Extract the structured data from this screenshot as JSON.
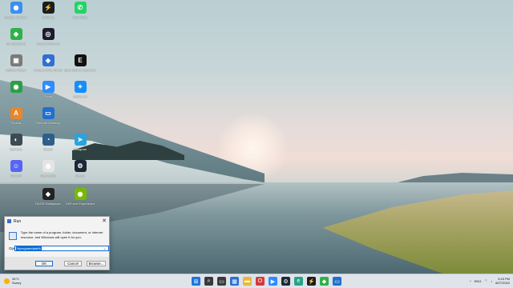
{
  "desktop_icons": [
    {
      "label": "Google Chrome",
      "icon": "chrome-icon",
      "color": "#3c8ef0",
      "glyph": "◉"
    },
    {
      "label": "Winamp",
      "icon": "winamp-icon",
      "color": "#1d1d1d",
      "glyph": "⚡"
    },
    {
      "label": "WhatsApp",
      "icon": "whatsapp-icon",
      "color": "#25d366",
      "glyph": "✆"
    },
    {
      "label": "BlueStacks 5",
      "icon": "bluestacks-icon",
      "color": "#2fb14a",
      "glyph": "◆"
    },
    {
      "label": "Ubisoft Connect",
      "icon": "ubisoft-icon",
      "color": "#1c1c2e",
      "glyph": "◎"
    },
    {
      "label": "Roblox Player",
      "icon": "roblox-icon",
      "color": "#7a7a7a",
      "glyph": "▣"
    },
    {
      "label": "Heroes of the Storm",
      "icon": "heroes-of-the-storm-icon",
      "color": "#2f6fd6",
      "glyph": "◈"
    },
    {
      "label": "Epic Games Launcher",
      "icon": "epic-games-icon",
      "color": "#111111",
      "glyph": "E"
    },
    {
      "label": "",
      "icon": "app-icon",
      "color": "#2d9e47",
      "glyph": "◉"
    },
    {
      "label": "Zoom",
      "icon": "zoom-icon",
      "color": "#2d8cff",
      "glyph": "▶"
    },
    {
      "label": "Battle.net",
      "icon": "battlenet-icon",
      "color": "#148eff",
      "glyph": "✦"
    },
    {
      "label": "Foobar",
      "icon": "foobar-icon",
      "color": "#e8872c",
      "glyph": "A"
    },
    {
      "label": "Remote Desktop",
      "icon": "remote-desktop-icon",
      "color": "#1f6fd1",
      "glyph": "▭"
    },
    {
      "label": "GeForce",
      "icon": "geforce-icon",
      "color": "#3c4a55",
      "glyph": "◐"
    },
    {
      "label": "Steam",
      "icon": "steam-icon",
      "color": "#2e5f8a",
      "glyph": "◔"
    },
    {
      "label": "Telegram",
      "icon": "telegram-icon",
      "color": "#2aa3df",
      "glyph": "➤"
    },
    {
      "label": "Discord",
      "icon": "discord-icon",
      "color": "#5865f2",
      "glyph": "☺"
    },
    {
      "label": "Overwatch",
      "icon": "overwatch-icon",
      "color": "#e4e4e4",
      "glyph": "◍"
    },
    {
      "label": "Steam",
      "icon": "steam-icon",
      "color": "#1b2838",
      "glyph": "⚙"
    },
    {
      "label": "RAGE Multiplayer",
      "icon": "rage-mp-icon",
      "color": "#222222",
      "glyph": "◆"
    },
    {
      "label": "GeForce Experience",
      "icon": "geforce-experience-icon",
      "color": "#76b900",
      "glyph": "◉"
    }
  ],
  "run_dialog": {
    "title": "Run",
    "close_glyph": "✕",
    "description": "Type the name of a program, folder, document, or Internet resource, and Windows will open it for you.",
    "open_label": "Open:",
    "open_value": "%programdata%",
    "dropdown_glyph": "⌄",
    "ok_label": "OK",
    "cancel_label": "Cancel",
    "browse_label": "Browse..."
  },
  "taskbar": {
    "weather_temp": "34°C",
    "weather_desc": "Sunny",
    "icons": [
      {
        "icon": "start-icon",
        "color": "#1e73d8",
        "glyph": "⊞"
      },
      {
        "icon": "search-icon",
        "color": "#3a3a3a",
        "glyph": "⌕"
      },
      {
        "icon": "task-view-icon",
        "color": "#3a3a3a",
        "glyph": "▭"
      },
      {
        "icon": "widgets-icon",
        "color": "#2b6fd0",
        "glyph": "▦"
      },
      {
        "icon": "file-explorer-icon",
        "color": "#e8b839",
        "glyph": "▬"
      },
      {
        "icon": "opera-gx-icon",
        "color": "#d33a3a",
        "glyph": "O"
      },
      {
        "icon": "zoom-icon",
        "color": "#2d8cff",
        "glyph": "▶"
      },
      {
        "icon": "steam-icon",
        "color": "#1b2838",
        "glyph": "⚙"
      },
      {
        "icon": "edge-icon",
        "color": "#2aa18a",
        "glyph": "e"
      },
      {
        "icon": "winamp-icon",
        "color": "#1d1d1d",
        "glyph": "⚡"
      },
      {
        "icon": "bluestacks-icon",
        "color": "#2fb14a",
        "glyph": "◆"
      },
      {
        "icon": "remote-desktop-icon",
        "color": "#1f6fd1",
        "glyph": "▭"
      }
    ],
    "tray_chevron": "^",
    "language": "ENG",
    "time": "3:15 PM",
    "date": "8/27/2022"
  }
}
